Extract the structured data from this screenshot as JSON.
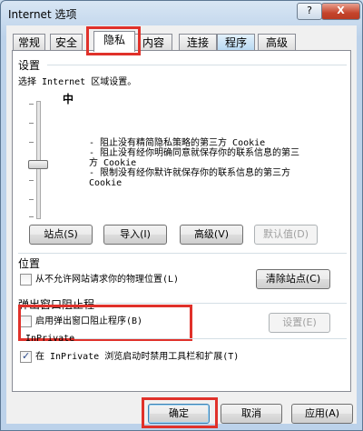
{
  "window": {
    "title": "Internet 选项",
    "help_glyph": "?",
    "close_glyph": "X"
  },
  "tabs": [
    {
      "label": "常规"
    },
    {
      "label": "安全"
    },
    {
      "label": "隐私",
      "active": true
    },
    {
      "label": "内容"
    },
    {
      "label": "连接"
    },
    {
      "label": "程序"
    },
    {
      "label": "高级"
    }
  ],
  "settings": {
    "group_title": "设置",
    "zone_label": "选择 Internet 区域设置。",
    "level": "中",
    "bullet_1_line1": "- 阻止没有精简隐私策略的第三方 Cookie",
    "bullet_2_line1": "- 阻止没有经你明确同意就保存你的联系信息的第三",
    "bullet_2_line2": "方 Cookie",
    "bullet_3_line1": "- 限制没有经你默许就保存你的联系信息的第三方",
    "bullet_3_line2": "Cookie",
    "buttons": {
      "sites": "站点(S)",
      "import": "导入(I)",
      "advanced": "高级(V)",
      "default": "默认值(D)"
    }
  },
  "location": {
    "group_title": "位置",
    "checkbox_label": "从不允许网站请求你的物理位置(L)",
    "clear_button": "清除站点(C)"
  },
  "popup": {
    "group_title": "弹出窗口阻止程",
    "checkbox_label": "启用弹出窗口阻止程序(B)",
    "settings_button": "设置(E)"
  },
  "inprivate": {
    "group_title": "InPrivate",
    "checkbox_label": "在 InPrivate 浏览启动时禁用工具栏和扩展(T)"
  },
  "footer": {
    "ok": "确定",
    "cancel": "取消",
    "apply": "应用(A)"
  },
  "slider_level": 0.5,
  "highlight_color": "#e0312a"
}
